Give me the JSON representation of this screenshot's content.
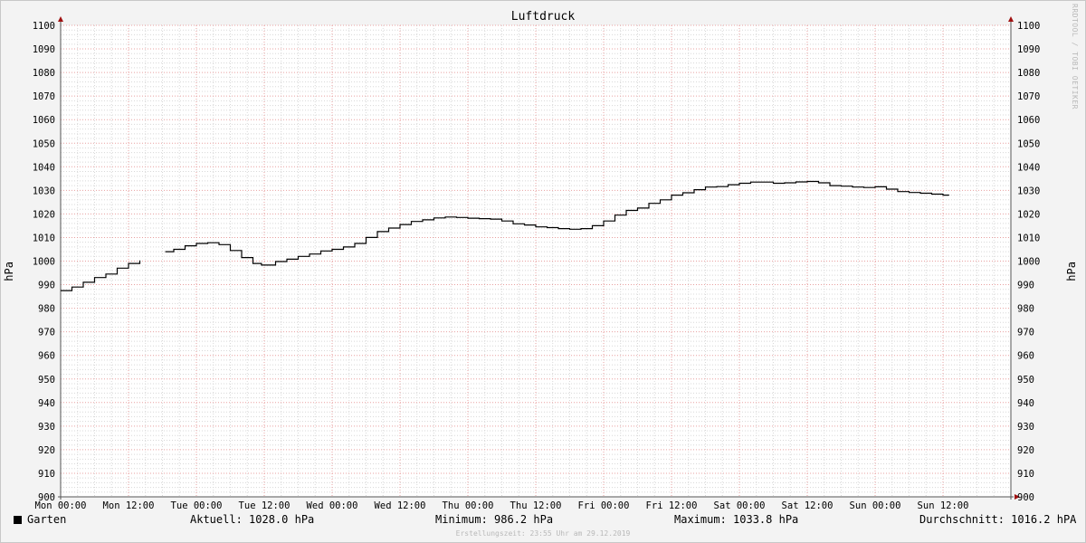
{
  "watermark": "RRDTOOL / TOBI OETIKER",
  "chart_data": {
    "type": "line",
    "title": "Luftdruck",
    "ylabel": "hPa",
    "ylim": [
      900,
      1100
    ],
    "ytick_step": 10,
    "x_ticks": [
      "Mon 00:00",
      "Mon 12:00",
      "Tue 00:00",
      "Tue 12:00",
      "Wed 00:00",
      "Wed 12:00",
      "Thu 00:00",
      "Thu 12:00",
      "Fri 00:00",
      "Fri 12:00",
      "Sat 00:00",
      "Sat 12:00",
      "Sun 00:00",
      "Sun 12:00"
    ],
    "x_unit": "hours since Mon 00:00",
    "xlim": [
      0,
      168
    ],
    "grid": true,
    "series": [
      {
        "name": "Garten",
        "color": "#000000",
        "points": [
          [
            0,
            987.5
          ],
          [
            2,
            989
          ],
          [
            4,
            991
          ],
          [
            6,
            993
          ],
          [
            8,
            994.5
          ],
          [
            10,
            997
          ],
          [
            12,
            999
          ],
          [
            14,
            1000.3
          ],
          [
            null,
            null
          ],
          [
            18.5,
            1004
          ],
          [
            20,
            1005
          ],
          [
            22,
            1006.5
          ],
          [
            24,
            1007.5
          ],
          [
            26,
            1007.8
          ],
          [
            28,
            1007
          ],
          [
            30,
            1004.5
          ],
          [
            32,
            1001.5
          ],
          [
            34,
            999
          ],
          [
            35.5,
            998.3
          ],
          [
            38,
            999.8
          ],
          [
            40,
            1000.8
          ],
          [
            42,
            1002
          ],
          [
            44,
            1003
          ],
          [
            46,
            1004.3
          ],
          [
            48,
            1005
          ],
          [
            50,
            1006
          ],
          [
            52,
            1007.5
          ],
          [
            54,
            1010
          ],
          [
            56,
            1012.5
          ],
          [
            58,
            1014
          ],
          [
            60,
            1015.5
          ],
          [
            62,
            1016.8
          ],
          [
            64,
            1017.5
          ],
          [
            66,
            1018.3
          ],
          [
            68,
            1018.7
          ],
          [
            70,
            1018.5
          ],
          [
            72,
            1018.2
          ],
          [
            74,
            1018
          ],
          [
            76,
            1017.8
          ],
          [
            78,
            1017
          ],
          [
            80,
            1015.8
          ],
          [
            82,
            1015.3
          ],
          [
            84,
            1014.5
          ],
          [
            86,
            1014.2
          ],
          [
            88,
            1013.8
          ],
          [
            90,
            1013.5
          ],
          [
            92,
            1013.8
          ],
          [
            94,
            1015
          ],
          [
            96,
            1017
          ],
          [
            98,
            1019.5
          ],
          [
            100,
            1021.5
          ],
          [
            102,
            1022.5
          ],
          [
            104,
            1024.5
          ],
          [
            106,
            1026
          ],
          [
            108,
            1028
          ],
          [
            110,
            1029
          ],
          [
            112,
            1030.3
          ],
          [
            114,
            1031.4
          ],
          [
            116,
            1031.6
          ],
          [
            118,
            1032.4
          ],
          [
            120,
            1033
          ],
          [
            122,
            1033.5
          ],
          [
            124,
            1033.5
          ],
          [
            126,
            1033
          ],
          [
            128,
            1033.2
          ],
          [
            130,
            1033.6
          ],
          [
            132,
            1033.8
          ],
          [
            134,
            1033.2
          ],
          [
            136,
            1032
          ],
          [
            138,
            1031.8
          ],
          [
            140,
            1031.4
          ],
          [
            142,
            1031.2
          ],
          [
            144,
            1031.5
          ],
          [
            146,
            1030.5
          ],
          [
            148,
            1029.5
          ],
          [
            150,
            1029.1
          ],
          [
            152,
            1028.8
          ],
          [
            154,
            1028.4
          ],
          [
            156,
            1028
          ],
          [
            157,
            1027.8
          ]
        ]
      }
    ]
  },
  "legend": {
    "series_label": "Garten",
    "current": "Aktuell: 1028.0 hPa",
    "minimum": "Minimum: 986.2 hPa",
    "maximum": "Maximum: 1033.8 hPa",
    "average": "Durchschnitt: 1016.2 hPA"
  },
  "footer": "Erstellungszeit: 23:55 Uhr am 29.12.2019"
}
